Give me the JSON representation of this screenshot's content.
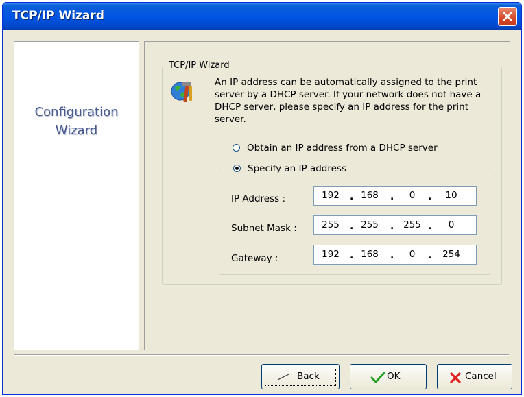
{
  "window": {
    "title": "TCP/IP Wizard"
  },
  "sidebar": {
    "line1": "Configuration",
    "line2": "Wizard"
  },
  "group": {
    "legend": "TCP/IP Wizard",
    "description": "An IP address can be automatically assigned to the print server by a DHCP server. If your network does not have a DHCP server, please specify an IP address for the print server.",
    "options": [
      {
        "label": "Obtain an IP address from a DHCP server",
        "selected": false
      },
      {
        "label": "Specify an IP address",
        "selected": true
      }
    ]
  },
  "fields": [
    {
      "label": "IP Address :",
      "octets": [
        "192",
        "168",
        "0",
        "10"
      ]
    },
    {
      "label": "Subnet Mask :",
      "octets": [
        "255",
        "255",
        "255",
        "0"
      ]
    },
    {
      "label": "Gateway :",
      "octets": [
        "192",
        "168",
        "0",
        "254"
      ]
    }
  ],
  "buttons": {
    "back": "Back",
    "ok": "OK",
    "cancel": "Cancel"
  },
  "colors": {
    "titlebar": "#0055e5",
    "dialog_bg": "#ece9d8",
    "ok_check": "#21a121",
    "cancel_x": "#e0201e"
  }
}
